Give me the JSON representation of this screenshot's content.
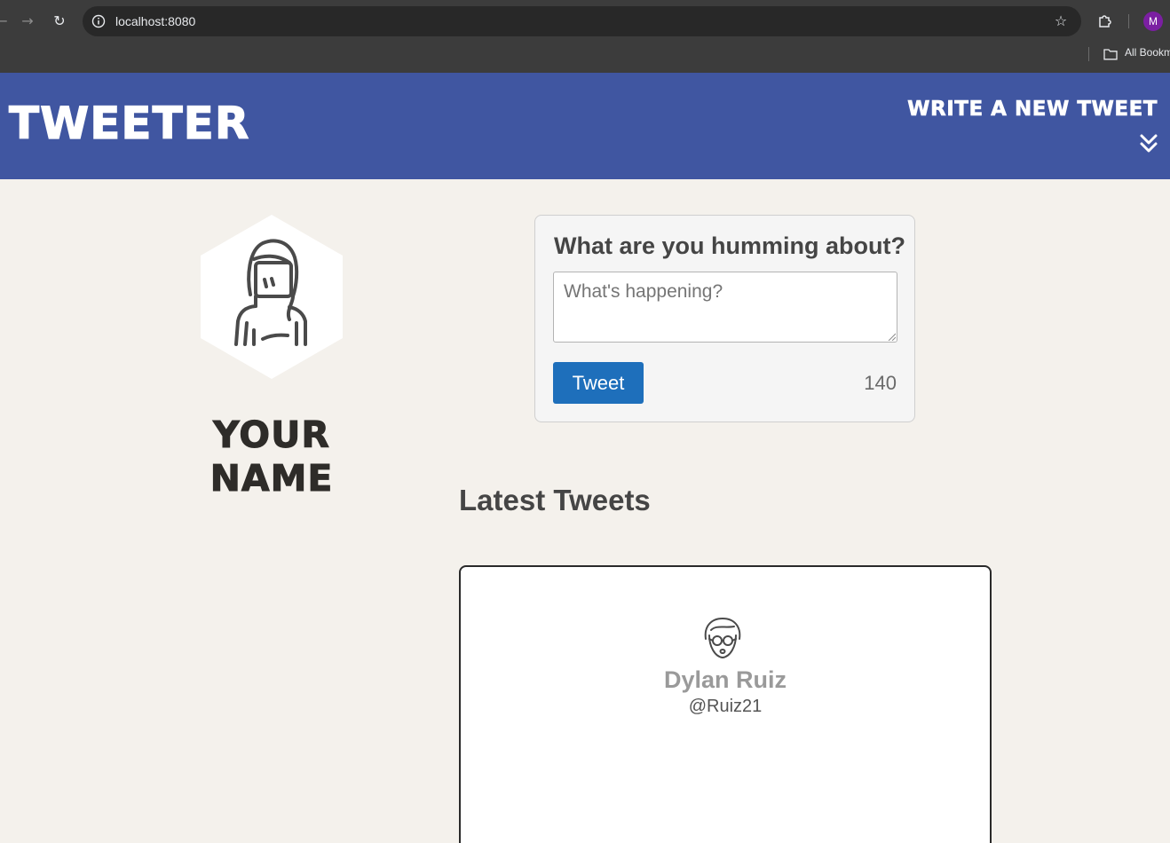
{
  "browser": {
    "url": "localhost:8080",
    "profile_initial": "M",
    "bookmarks_label": "All Bookm",
    "icons": [
      "back-icon",
      "forward-icon",
      "reload-icon",
      "info-icon",
      "star-icon",
      "extensions-icon",
      "folder-icon"
    ]
  },
  "nav": {
    "brand": "Tweeter",
    "write_new": "Write a new tweet",
    "color": "#4056a1"
  },
  "profile": {
    "name": "Your Name"
  },
  "compose": {
    "title": "What are you humming about?",
    "placeholder": "What's happening?",
    "value": "",
    "button_label": "Tweet",
    "counter": "140",
    "button_color": "#1e6fbb"
  },
  "feed": {
    "heading": "Latest Tweets",
    "tweets": [
      {
        "name": "Dylan Ruiz",
        "handle": "@Ruiz21"
      }
    ]
  }
}
